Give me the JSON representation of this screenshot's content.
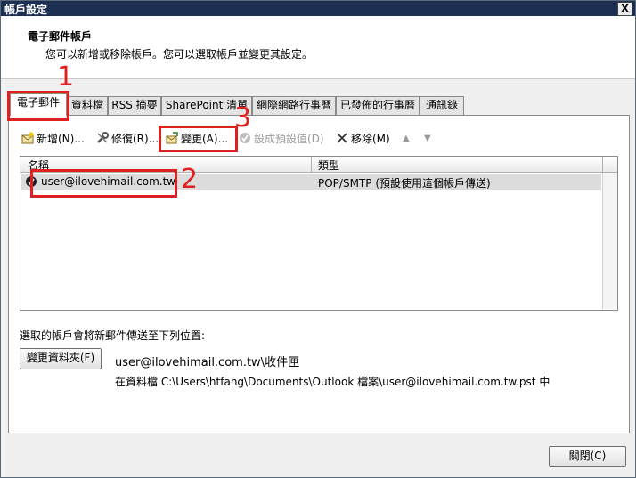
{
  "window": {
    "title": "帳戶設定",
    "close_glyph": "X"
  },
  "header": {
    "title": "電子郵件帳戶",
    "subtitle": "您可以新增或移除帳戶。您可以選取帳戶並變更其設定。"
  },
  "tabs": [
    {
      "label": "電子郵件"
    },
    {
      "label": "資料檔"
    },
    {
      "label": "RSS 摘要"
    },
    {
      "label": "SharePoint 清單"
    },
    {
      "label": "網際網路行事曆"
    },
    {
      "label": "已發佈的行事曆"
    },
    {
      "label": "通訊錄"
    }
  ],
  "toolbar": {
    "new_label": "新增(N)...",
    "repair_label": "修復(R)...",
    "change_label": "變更(A)...",
    "set_default_label": "設成預設值(D)",
    "remove_label": "移除(M)",
    "move_up_glyph": "▲",
    "move_down_glyph": "▼"
  },
  "list": {
    "columns": [
      "名稱",
      "類型"
    ],
    "rows": [
      {
        "name": "user@ilovehimail.com.tw",
        "type": "POP/SMTP (預設使用這個帳戶傳送)"
      }
    ]
  },
  "delivery": {
    "label": "選取的帳戶會將新郵件傳送至下列位置:",
    "change_folder_label": "變更資料夾(F)",
    "folder_path": "user@ilovehimail.com.tw\\收件匣",
    "data_file": "在資料檔 C:\\Users\\htfang\\Documents\\Outlook 檔案\\user@ilovehimail.com.tw.pst 中"
  },
  "footer": {
    "close_label": "關閉(C)"
  },
  "annotations": {
    "one": "1",
    "two": "2",
    "three": "3",
    "color": "#e02020"
  }
}
